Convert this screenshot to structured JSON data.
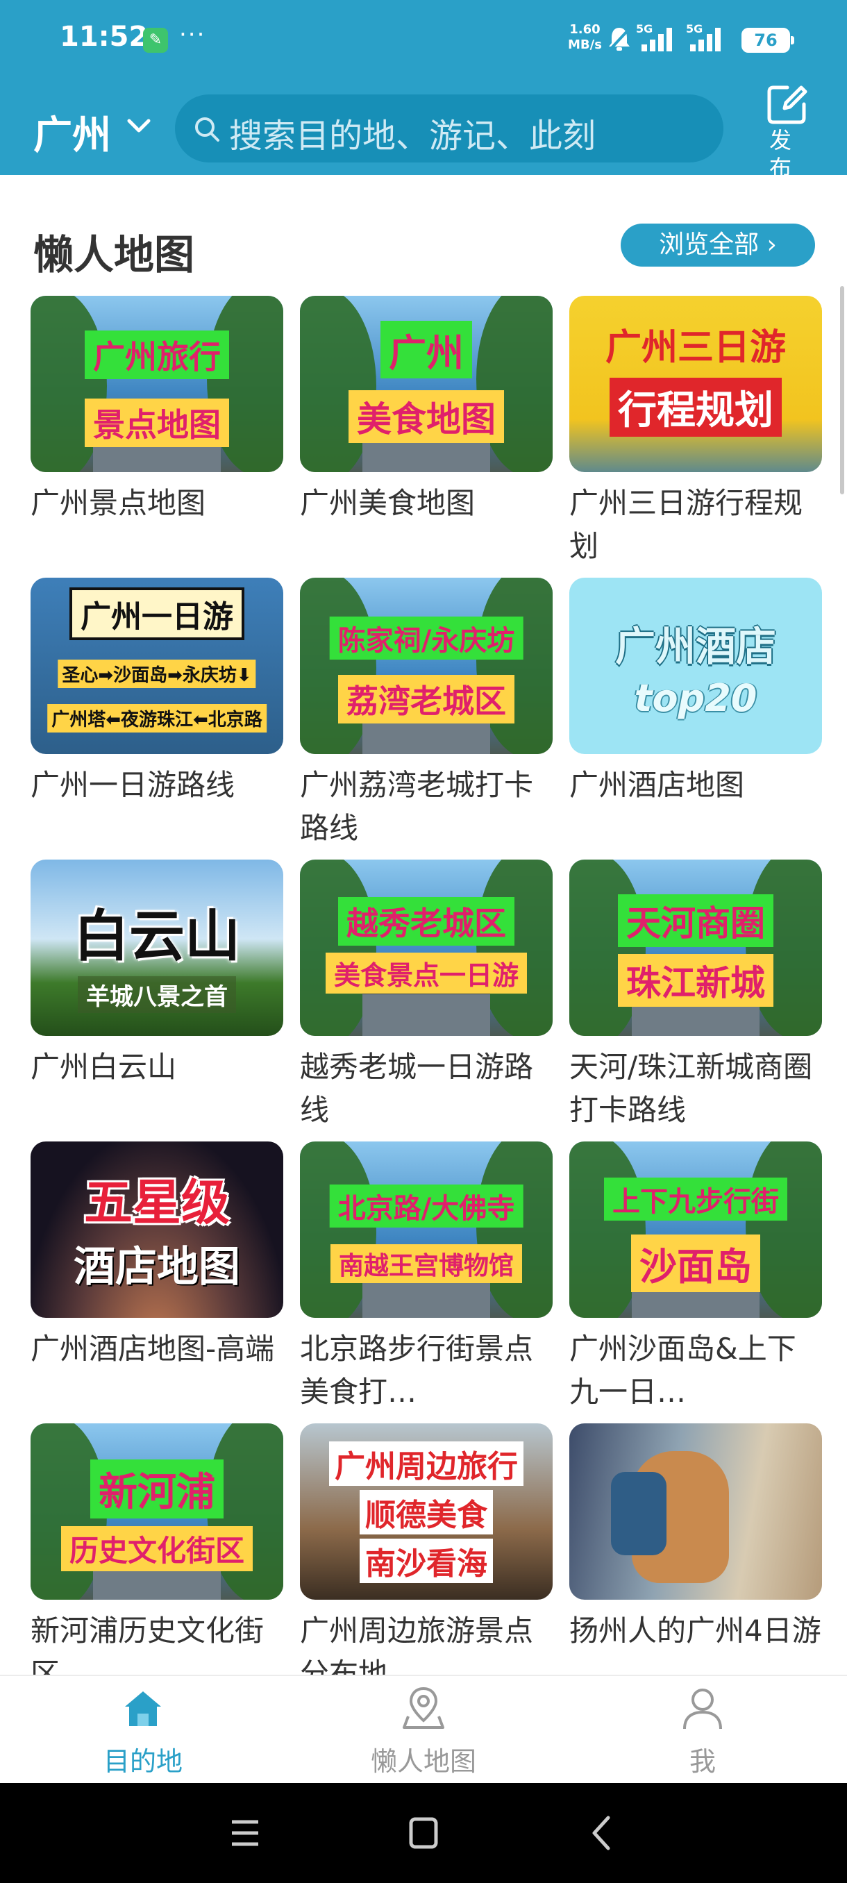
{
  "status": {
    "time": "11:52",
    "net_speed_value": "1.60",
    "net_speed_unit": "MB/s",
    "signal1": "5G",
    "signal2": "5G",
    "battery": "76"
  },
  "header": {
    "city": "广州",
    "search_placeholder": "搜索目的地、游记、此刻",
    "publish_label": "发布"
  },
  "section": {
    "title": "懒人地图",
    "browse_all": "浏览全部 ›"
  },
  "cards": [
    {
      "title": "广州景点地图",
      "label1": "广州旅行",
      "label2": "景点地图"
    },
    {
      "title": "广州美食地图",
      "label1": "广州",
      "label2": "美食地图"
    },
    {
      "title": "广州三日游行程规划",
      "label1": "广州三日游",
      "label2": "行程规划"
    },
    {
      "title": "广州一日游路线",
      "label1": "广州一日游",
      "label2": "圣心➡沙面岛➡永庆坊⬇",
      "label3": "广州塔⬅夜游珠江⬅北京路"
    },
    {
      "title": "广州荔湾老城打卡路线",
      "label1": "陈家祠/永庆坊",
      "label2": "荔湾老城区"
    },
    {
      "title": "广州酒店地图",
      "label1": "广州酒店",
      "label2": "top20"
    },
    {
      "title": "广州白云山",
      "label1": "白云山",
      "label2": "羊城八景之首"
    },
    {
      "title": "越秀老城一日游路线",
      "label1": "越秀老城区",
      "label2": "美食景点一日游"
    },
    {
      "title": "天河/珠江新城商圈打卡路线",
      "label1": "天河商圈",
      "label2": "珠江新城"
    },
    {
      "title": "广州酒店地图-高端",
      "label1": "五星级",
      "label2": "酒店地图"
    },
    {
      "title": "北京路步行街景点美食打…",
      "label1": "北京路/大佛寺",
      "label2": "南越王宫博物馆"
    },
    {
      "title": "广州沙面岛&上下九一日…",
      "label1": "上下九步行街",
      "label2": "沙面岛"
    },
    {
      "title": "新河浦历史文化街区",
      "label1": "新河浦",
      "label2": "历史文化街区"
    },
    {
      "title": "广州周边旅游景点分布地…",
      "label1": "广州周边旅行",
      "label2": "顺德美食",
      "label3": "南沙看海"
    },
    {
      "title": "扬州人的广州4日游"
    }
  ],
  "bottom_nav": {
    "items": [
      {
        "label": "目的地",
        "icon": "home-icon",
        "active": true
      },
      {
        "label": "懒人地图",
        "icon": "map-pin-icon",
        "active": false
      },
      {
        "label": "我",
        "icon": "profile-icon",
        "active": false
      }
    ]
  },
  "colors": {
    "brand": "#2aa0c8",
    "label_green": "#34e03a",
    "label_yellow": "#ffd447",
    "label_text": "#e0206b"
  }
}
